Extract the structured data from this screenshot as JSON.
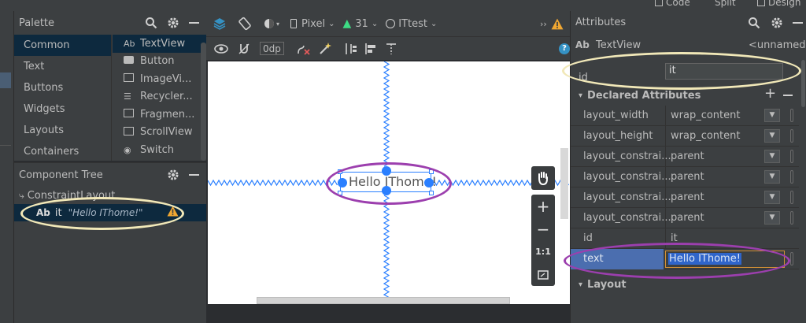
{
  "top_tabs": {
    "code": "Code",
    "split": "Split",
    "design": "Design"
  },
  "palette": {
    "title": "Palette",
    "categories": [
      "Common",
      "Text",
      "Buttons",
      "Widgets",
      "Layouts",
      "Containers"
    ],
    "items": [
      "TextView",
      "Button",
      "ImageVi...",
      "Recycler...",
      "Fragmen...",
      "ScrollView",
      "Switch"
    ]
  },
  "component_tree": {
    "title": "Component Tree",
    "root": "ConstraintLayout",
    "child_prefix": "Ab",
    "child_id": "it",
    "child_text": "\"Hello IThome!\""
  },
  "toolbar": {
    "device": "Pixel",
    "api": "31",
    "theme": "ITtest",
    "margin": "0dp",
    "overflow": "››"
  },
  "canvas": {
    "textview_text": "Hello IThome!",
    "zoom_ratio": "1:1"
  },
  "attributes": {
    "title": "Attributes",
    "widget_prefix": "Ab",
    "widget_type": "TextView",
    "widget_name": "<unnamed>",
    "id_label": "id",
    "id_value": "it",
    "declared_title": "Declared Attributes",
    "rows": [
      {
        "key": "layout_width",
        "value": "wrap_content"
      },
      {
        "key": "layout_height",
        "value": "wrap_content"
      },
      {
        "key": "layout_constrai...",
        "value": "parent"
      },
      {
        "key": "layout_constrai...",
        "value": "parent"
      },
      {
        "key": "layout_constrai...",
        "value": "parent"
      },
      {
        "key": "layout_constrai...",
        "value": "parent"
      },
      {
        "key": "id",
        "value": "it"
      }
    ],
    "text_key": "text",
    "text_value": "Hello IThome!",
    "layout_title": "Layout"
  },
  "colors": {
    "annotation_purple": "#9c3fae",
    "annotation_cream": "#f1e8b8",
    "selection_blue": "#2a7fff",
    "warning": "#f0a732",
    "android_green": "#3ddc84",
    "selected_row": "#4b6eaf"
  }
}
